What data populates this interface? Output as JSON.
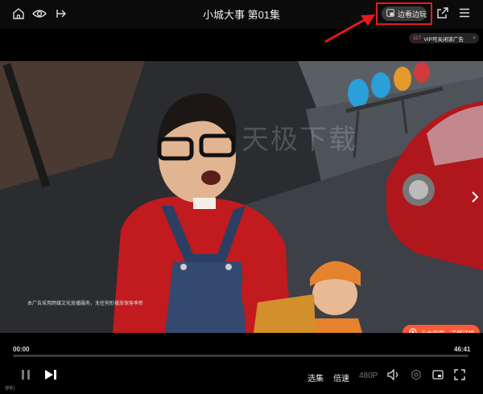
{
  "header": {
    "title": "小城大事 第01集",
    "side_by_side_label": "边看边玩"
  },
  "ad": {
    "countdown": "117",
    "vip_text": "VIP可关闭该广告",
    "close_symbol": "×",
    "subtitle_note": "本广告采用跨媒文化放播服务，无任何形播放保客季新",
    "cta_label": "点击画面，了解详情",
    "watermark": "天极下载"
  },
  "player": {
    "current_time": "00:00",
    "total_time": "46:41",
    "progress": 0.0,
    "episodes_label": "选集",
    "speed_label": "倍速",
    "quality_label": "480P",
    "corner_label": "伊利"
  },
  "colors": {
    "accent_red": "#e31b1b",
    "ad_orange": "#ff5a35"
  }
}
